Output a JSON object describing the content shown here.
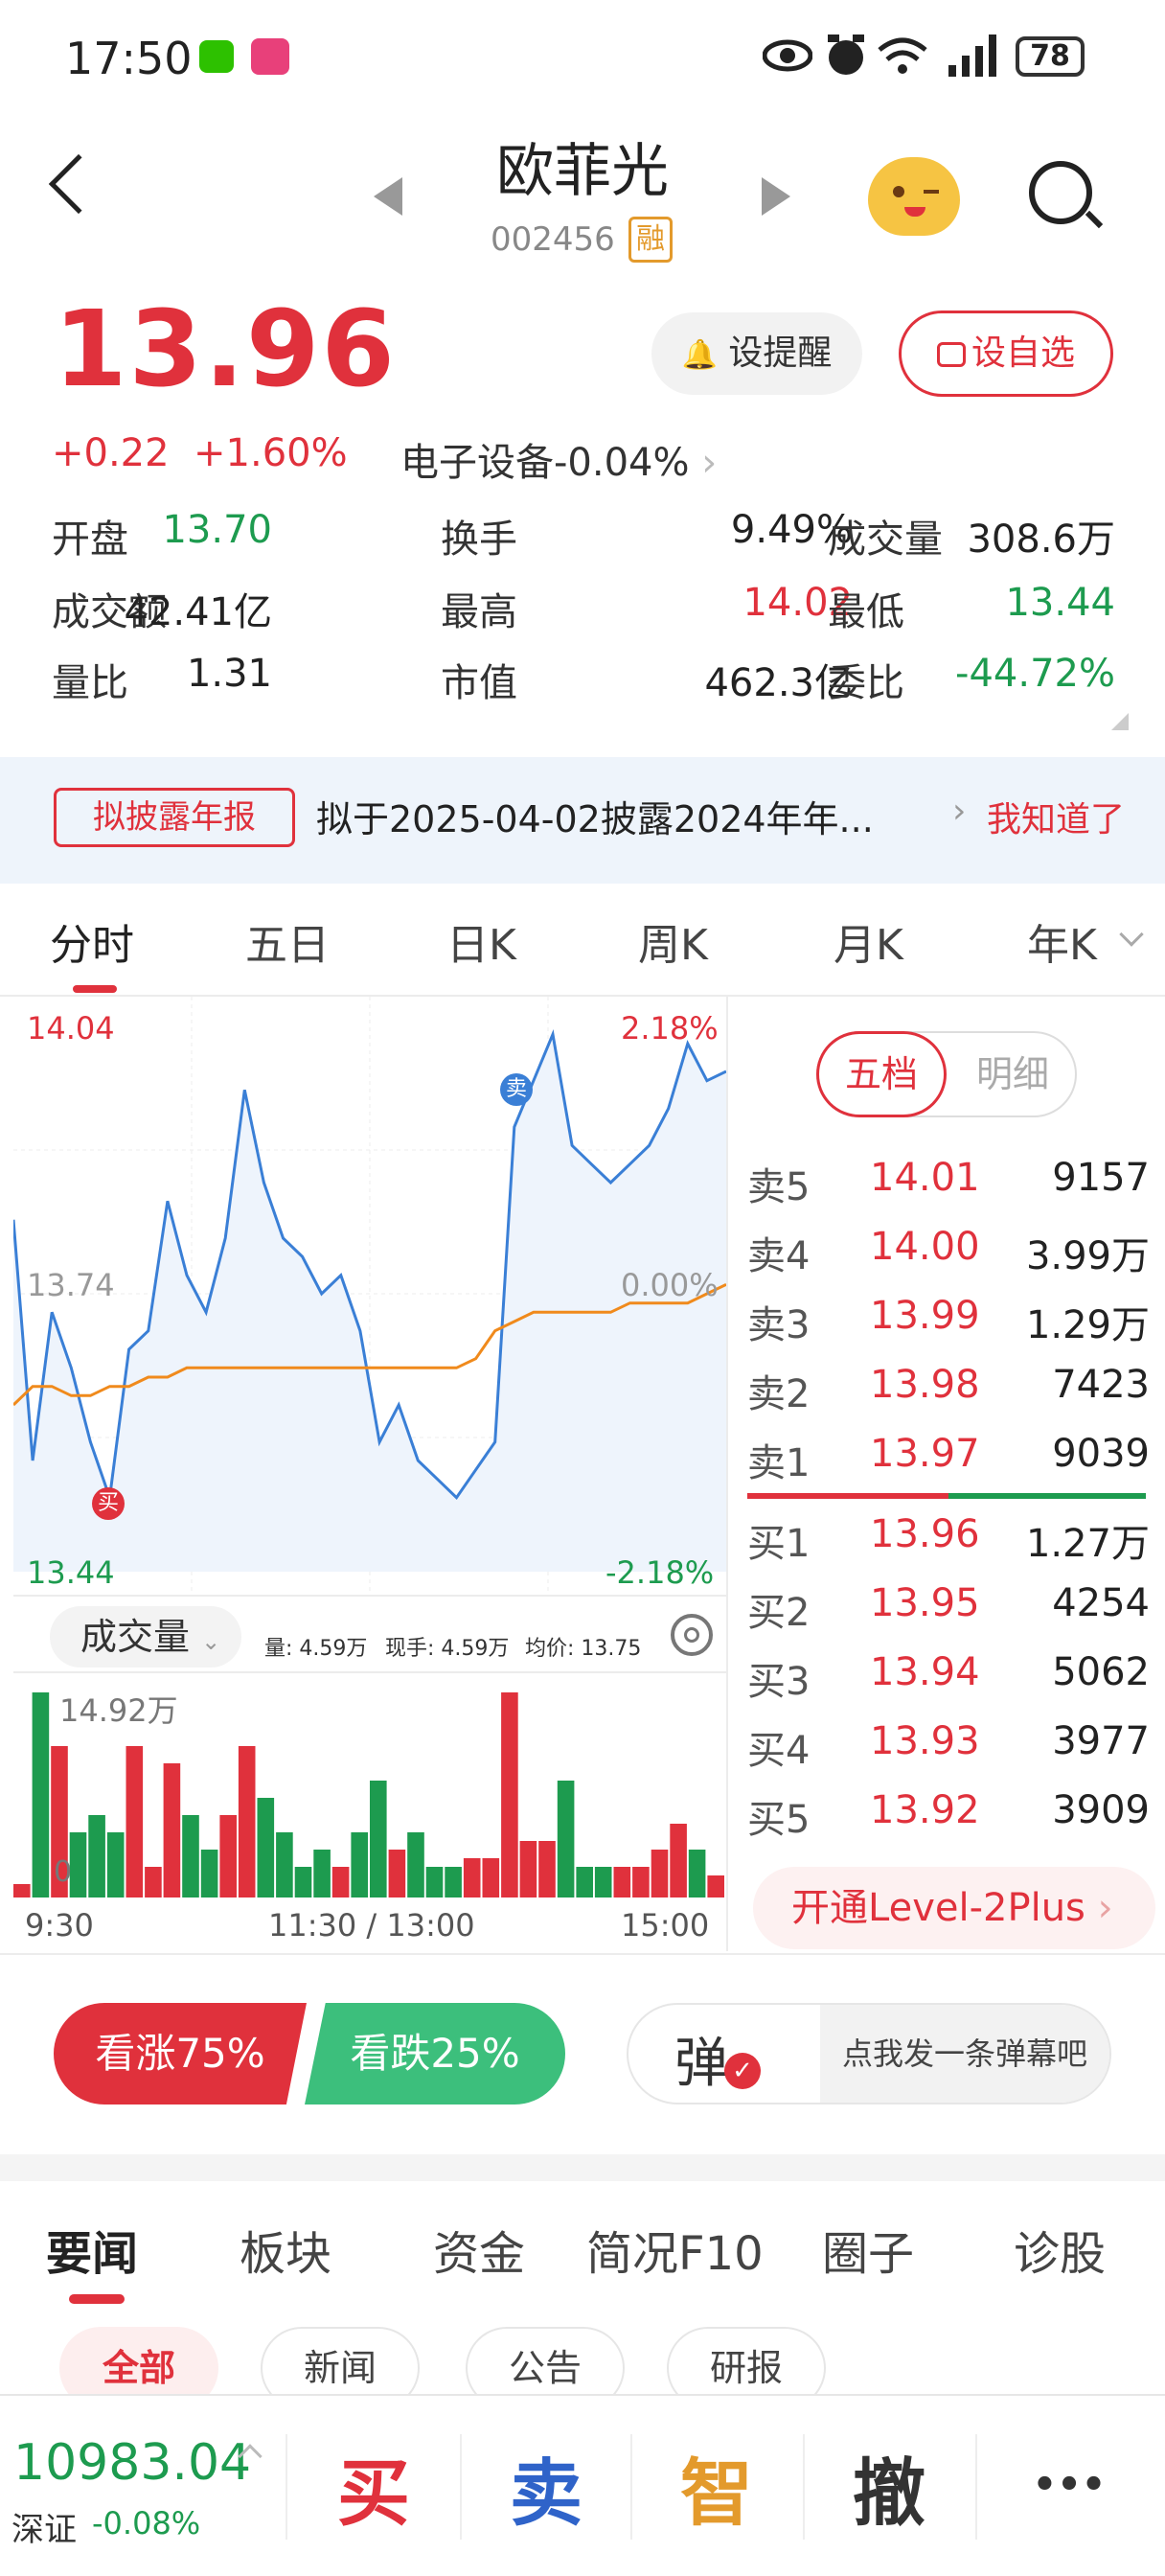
{
  "status_bar": {
    "time": "17:50",
    "battery": "78"
  },
  "header": {
    "name": "欧菲光",
    "code": "002456",
    "margin_tag": "融"
  },
  "quote": {
    "price": "13.96",
    "change": "+0.22",
    "change_pct": "+1.60%",
    "sector": "电子设备-0.04%",
    "alert_btn": "设提醒",
    "watch_btn": "设自选"
  },
  "stats": [
    {
      "label": "开盘",
      "value": "13.70",
      "color": "#1d9b4f"
    },
    {
      "label": "换手",
      "value": "9.49%",
      "color": "#222222"
    },
    {
      "label": "成交量",
      "value": "308.6万",
      "color": "#222222"
    },
    {
      "label": "成交额",
      "value": "42.41亿",
      "color": "#222222"
    },
    {
      "label": "最高",
      "value": "14.02",
      "color": "#e0313c"
    },
    {
      "label": "最低",
      "value": "13.44",
      "color": "#1d9b4f"
    },
    {
      "label": "量比",
      "value": "1.31",
      "color": "#222222"
    },
    {
      "label": "市值",
      "value": "462.3亿",
      "color": "#222222"
    },
    {
      "label": "委比",
      "value": "-44.72%",
      "color": "#1d9b4f"
    }
  ],
  "notice": {
    "tag": "拟披露年报",
    "text": "拟于2025-04-02披露2024年年...",
    "ack": "我知道了"
  },
  "chart_tabs": [
    "分时",
    "五日",
    "日K",
    "周K",
    "月K",
    "年K"
  ],
  "intraday": {
    "y_top": "14.04",
    "y_mid": "13.74",
    "y_bot": "13.44",
    "pct_top": "2.18%",
    "pct_mid": "0.00%",
    "pct_bot": "-2.18%",
    "buy_marker": "买",
    "sell_marker": "卖",
    "volume_label": "成交量",
    "vol_info": "量: 4.59万",
    "hand_info": "现手: 4.59万",
    "avg_info": "均价: 13.75",
    "vol_max": "14.92万",
    "vol_zero": "0",
    "times": [
      "9:30",
      "11:30 / 13:00",
      "15:00"
    ]
  },
  "chart_data": {
    "type": "line",
    "ylim": [
      13.44,
      14.04
    ],
    "series": [
      {
        "values": [
          13.82,
          13.56,
          13.72,
          13.66,
          13.58,
          13.52,
          13.68,
          13.7,
          13.84,
          13.76,
          13.72,
          13.8,
          13.96,
          13.86,
          13.8,
          13.78,
          13.74,
          13.76,
          13.7,
          13.58,
          13.62,
          13.56,
          13.54,
          13.52,
          13.55,
          13.58,
          13.92,
          13.97,
          14.02,
          13.9,
          13.88,
          13.86,
          13.88,
          13.9,
          13.94,
          14.01,
          13.97,
          13.98
        ]
      },
      {
        "values": [
          13.62,
          13.64,
          13.64,
          13.63,
          13.63,
          13.64,
          13.64,
          13.65,
          13.65,
          13.66,
          13.66,
          13.66,
          13.66,
          13.66,
          13.66,
          13.66,
          13.66,
          13.66,
          13.66,
          13.66,
          13.66,
          13.66,
          13.66,
          13.66,
          13.67,
          13.7,
          13.71,
          13.72,
          13.72,
          13.72,
          13.72,
          13.72,
          13.73,
          13.73,
          13.73,
          13.73,
          13.74,
          13.75
        ]
      }
    ]
  },
  "order_book": {
    "tab_five": "五档",
    "tab_detail": "明细",
    "asks": [
      {
        "label": "卖5",
        "price": "14.01",
        "vol": "9157"
      },
      {
        "label": "卖4",
        "price": "14.00",
        "vol": "3.99万"
      },
      {
        "label": "卖3",
        "price": "13.99",
        "vol": "1.29万"
      },
      {
        "label": "卖2",
        "price": "13.98",
        "vol": "7423"
      },
      {
        "label": "卖1",
        "price": "13.97",
        "vol": "9039"
      }
    ],
    "bids": [
      {
        "label": "买1",
        "price": "13.96",
        "vol": "1.27万"
      },
      {
        "label": "买2",
        "price": "13.95",
        "vol": "4254"
      },
      {
        "label": "买3",
        "price": "13.94",
        "vol": "5062"
      },
      {
        "label": "买4",
        "price": "13.93",
        "vol": "3977"
      },
      {
        "label": "买5",
        "price": "13.92",
        "vol": "3909"
      }
    ],
    "level2": "开通Level-2Plus"
  },
  "sentiment": {
    "bull": "看涨75%",
    "bear": "看跌25%",
    "danmu_icon": "弹",
    "danmu_prompt": "点我发一条弹幕吧"
  },
  "news_tabs": [
    "要闻",
    "板块",
    "资金",
    "简况F10",
    "圈子",
    "诊股"
  ],
  "news_filters": [
    "全部",
    "新闻",
    "公告",
    "研报"
  ],
  "bottom_bar": {
    "index_value": "10983.04",
    "index_name": "深证",
    "index_change": "-0.08%",
    "buy": "买",
    "sell": "卖",
    "smart": "智",
    "cancel": "撤",
    "more": "•••"
  }
}
